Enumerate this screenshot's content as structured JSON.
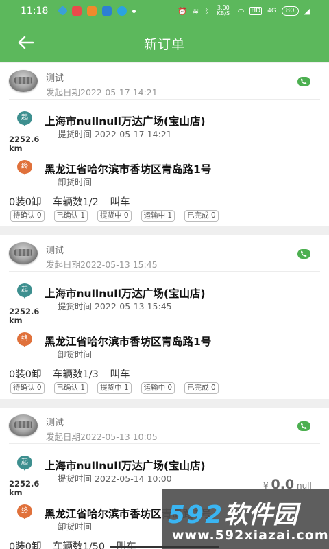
{
  "status_bar": {
    "time": "11:18",
    "speed": "3.00 KB/S",
    "network": "HD",
    "signal": "4G",
    "battery": "80"
  },
  "header": {
    "title": "新订单",
    "back_icon": "arrow-left-icon"
  },
  "colors": {
    "header_green": "#5cb85c",
    "start_pin": "#3d8f8f",
    "end_pin": "#e0713b",
    "phone_green": "#4caf50"
  },
  "orders": [
    {
      "username": "测试",
      "created": "发起日期2022-05-17 14:21",
      "start_pin": "起",
      "start_address": "上海市nullnull万达广场(宝山店)",
      "pickup_time": "提货时间 2022-05-17 14:21",
      "distance": "2252.6 km",
      "end_pin": "终",
      "end_address": "黑龙江省哈尔滨市香坊区青岛路1号",
      "unload_time": "卸货时间",
      "summary": {
        "load": "0装0卸",
        "vehicles": "车辆数1/2",
        "action": "叫车"
      },
      "tags": [
        "待确认 0",
        "已确认 1",
        "提货中 0",
        "运输中 1",
        "已完成 0"
      ]
    },
    {
      "username": "测试",
      "created": "发起日期2022-05-13 15:45",
      "start_pin": "起",
      "start_address": "上海市nullnull万达广场(宝山店)",
      "pickup_time": "提货时间 2022-05-13 15:45",
      "distance": "2252.6 km",
      "end_pin": "终",
      "end_address": "黑龙江省哈尔滨市香坊区青岛路1号",
      "unload_time": "卸货时间",
      "summary": {
        "load": "0装0卸",
        "vehicles": "车辆数1/3",
        "action": "叫车"
      },
      "tags": [
        "待确认 0",
        "已确认 1",
        "提货中 1",
        "运输中 0",
        "已完成 0"
      ]
    },
    {
      "username": "测试",
      "created": "发起日期2022-05-13 10:05",
      "start_pin": "起",
      "start_address": "上海市nullnull万达广场(宝山店)",
      "pickup_time": "提货时间 2022-05-14 10:00",
      "distance": "2252.6 km",
      "end_pin": "终",
      "end_address": "黑龙江省哈尔滨市香坊区青岛路1号",
      "unload_time": "卸货时间",
      "price_symbol": "¥",
      "price_value": "0.0",
      "price_unit": "null",
      "summary": {
        "load": "0装0卸",
        "vehicles": "车辆数1/50",
        "action": "叫车"
      },
      "tags": []
    }
  ],
  "watermark": {
    "number": "592",
    "brand": "软件园",
    "url": "www.592xiazai.com"
  }
}
